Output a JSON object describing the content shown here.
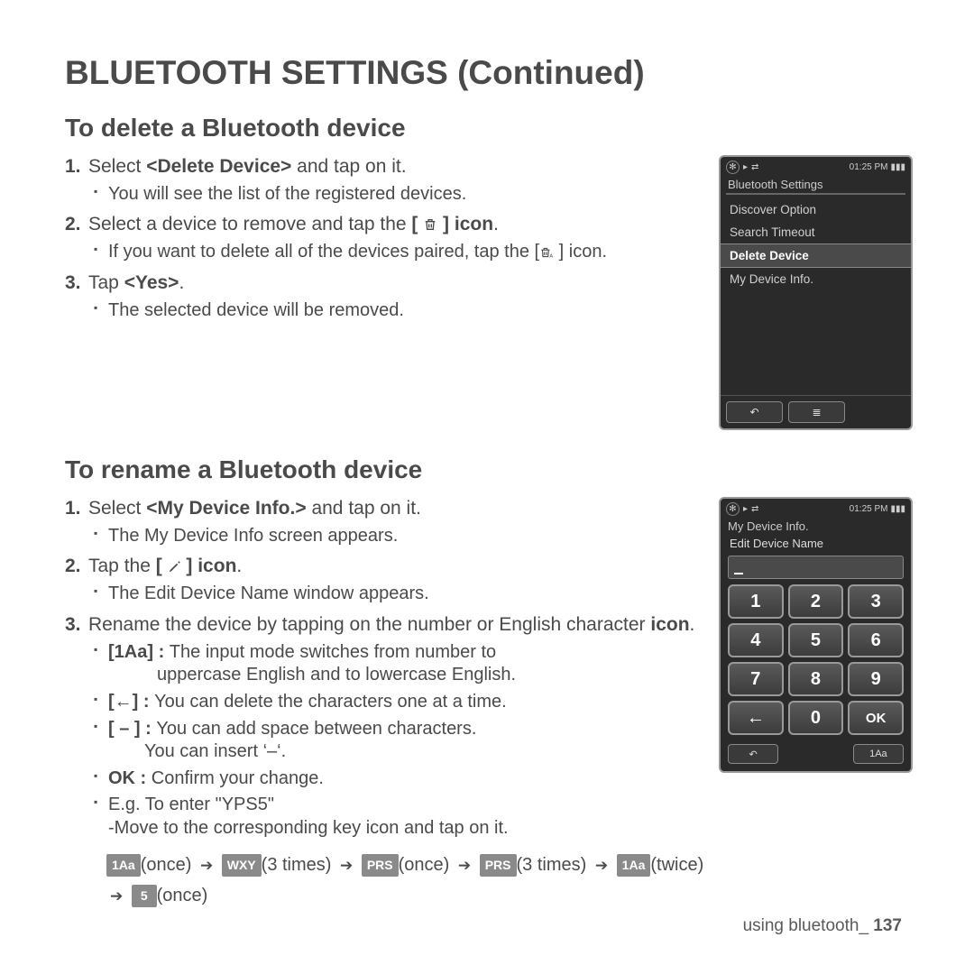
{
  "page_title": "BLUETOOTH SETTINGS (Continued)",
  "section1": {
    "title": "To delete a Bluetooth device",
    "steps": [
      {
        "n": "1.",
        "pre": "Select ",
        "bold": "<Delete Device>",
        "post": " and tap on it.",
        "sub": [
          "You will see the list of the registered devices."
        ]
      },
      {
        "n": "2.",
        "text_html": "Select a device to remove and tap the <b>[ {TRASH} ] icon</b>.",
        "sub": [
          "If you want to delete all of the devices paired, tap the [ {TRASHA} ] icon."
        ]
      },
      {
        "n": "3.",
        "pre": "Tap ",
        "bold": "<Yes>",
        "post": ".",
        "sub": [
          "The selected device will be removed."
        ]
      }
    ]
  },
  "section2": {
    "title": "To rename a Bluetooth device",
    "steps": [
      {
        "n": "1.",
        "pre": "Select ",
        "bold": "<My Device Info.>",
        "post": " and tap on it.",
        "sub": [
          "The My Device Info screen appears."
        ]
      },
      {
        "n": "2.",
        "text_html": "Tap the <b>[ {PENCIL} ] icon</b>.",
        "sub": [
          "The Edit Device Name window appears."
        ]
      },
      {
        "n": "3.",
        "text": "Rename the device by tapping on the number or English character ",
        "bold_trail": "icon",
        "post2": ".",
        "sub_custom": true
      }
    ],
    "subs3": {
      "a_label": "[1Aa] : ",
      "a_text": "The input mode switches from number to uppercase English and to lowercase English.",
      "b_label": "[←] : ",
      "b_text": "You can delete the characters one at a time.",
      "c_label": "[ – ] : ",
      "c_text1": "You can add space between characters.",
      "c_text2": "You can insert ‘–‘.",
      "d_label": "OK : ",
      "d_text": "Confirm your change.",
      "e_text": "E.g. To enter \"YPS5\"",
      "e_text2": "-Move to the corresponding key icon and tap on it."
    },
    "example_seq": [
      {
        "chip": "1Aa",
        "note": "(once)"
      },
      {
        "chip": "WXY",
        "note": "(3 times)"
      },
      {
        "chip": "PRS",
        "note": "(once)"
      },
      {
        "chip": "PRS",
        "note": "(3 times)"
      },
      {
        "chip": "1Aa",
        "note": "(twice)"
      },
      {
        "chip": "5",
        "note": "(once)"
      }
    ]
  },
  "phone1": {
    "time": "01:25 PM",
    "title": "Bluetooth Settings",
    "items": [
      "Discover Option",
      "Search Timeout",
      "Delete Device",
      "My Device Info."
    ],
    "selected_index": 2
  },
  "phone2": {
    "time": "01:25 PM",
    "title": "My Device Info.",
    "subtitle": "Edit Device Name",
    "keys": [
      "1",
      "2",
      "3",
      "4",
      "5",
      "6",
      "7",
      "8",
      "9",
      "←",
      "0",
      "OK"
    ],
    "bottom_right": "1Aa"
  },
  "footer": {
    "label": "using bluetooth_",
    "page": "137"
  }
}
